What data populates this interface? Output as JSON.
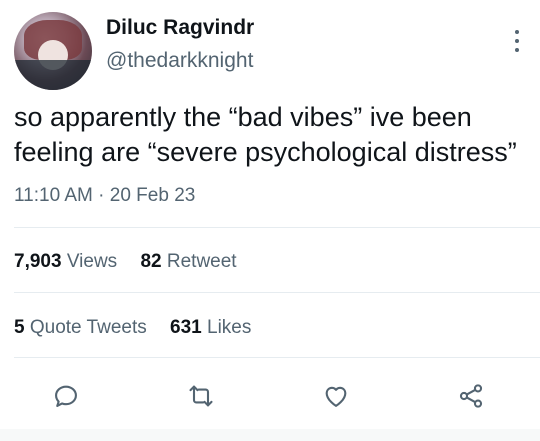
{
  "user": {
    "name": "Diluc Ragvindr",
    "handle": "@thedarkknight"
  },
  "tweet": {
    "text_line1": "so apparently the “bad vibes” ive been",
    "text_line2": "feeling are “severe psychological distress”",
    "time": "11:10 AM",
    "separator": "·",
    "date": "20 Feb 23"
  },
  "stats": {
    "views_count": "7,903",
    "views_label": "Views",
    "retweets_count": "82",
    "retweets_label": "Retweet",
    "quotes_count": "5",
    "quotes_label": "Quote Tweets",
    "likes_count": "631",
    "likes_label": "Likes"
  },
  "icons": {
    "more": "more-vertical-icon",
    "reply": "reply-icon",
    "retweet": "retweet-icon",
    "like": "heart-icon",
    "share": "share-icon"
  },
  "colors": {
    "text": "#0f1419",
    "secondary": "#536471",
    "divider": "#e6ecf0"
  }
}
